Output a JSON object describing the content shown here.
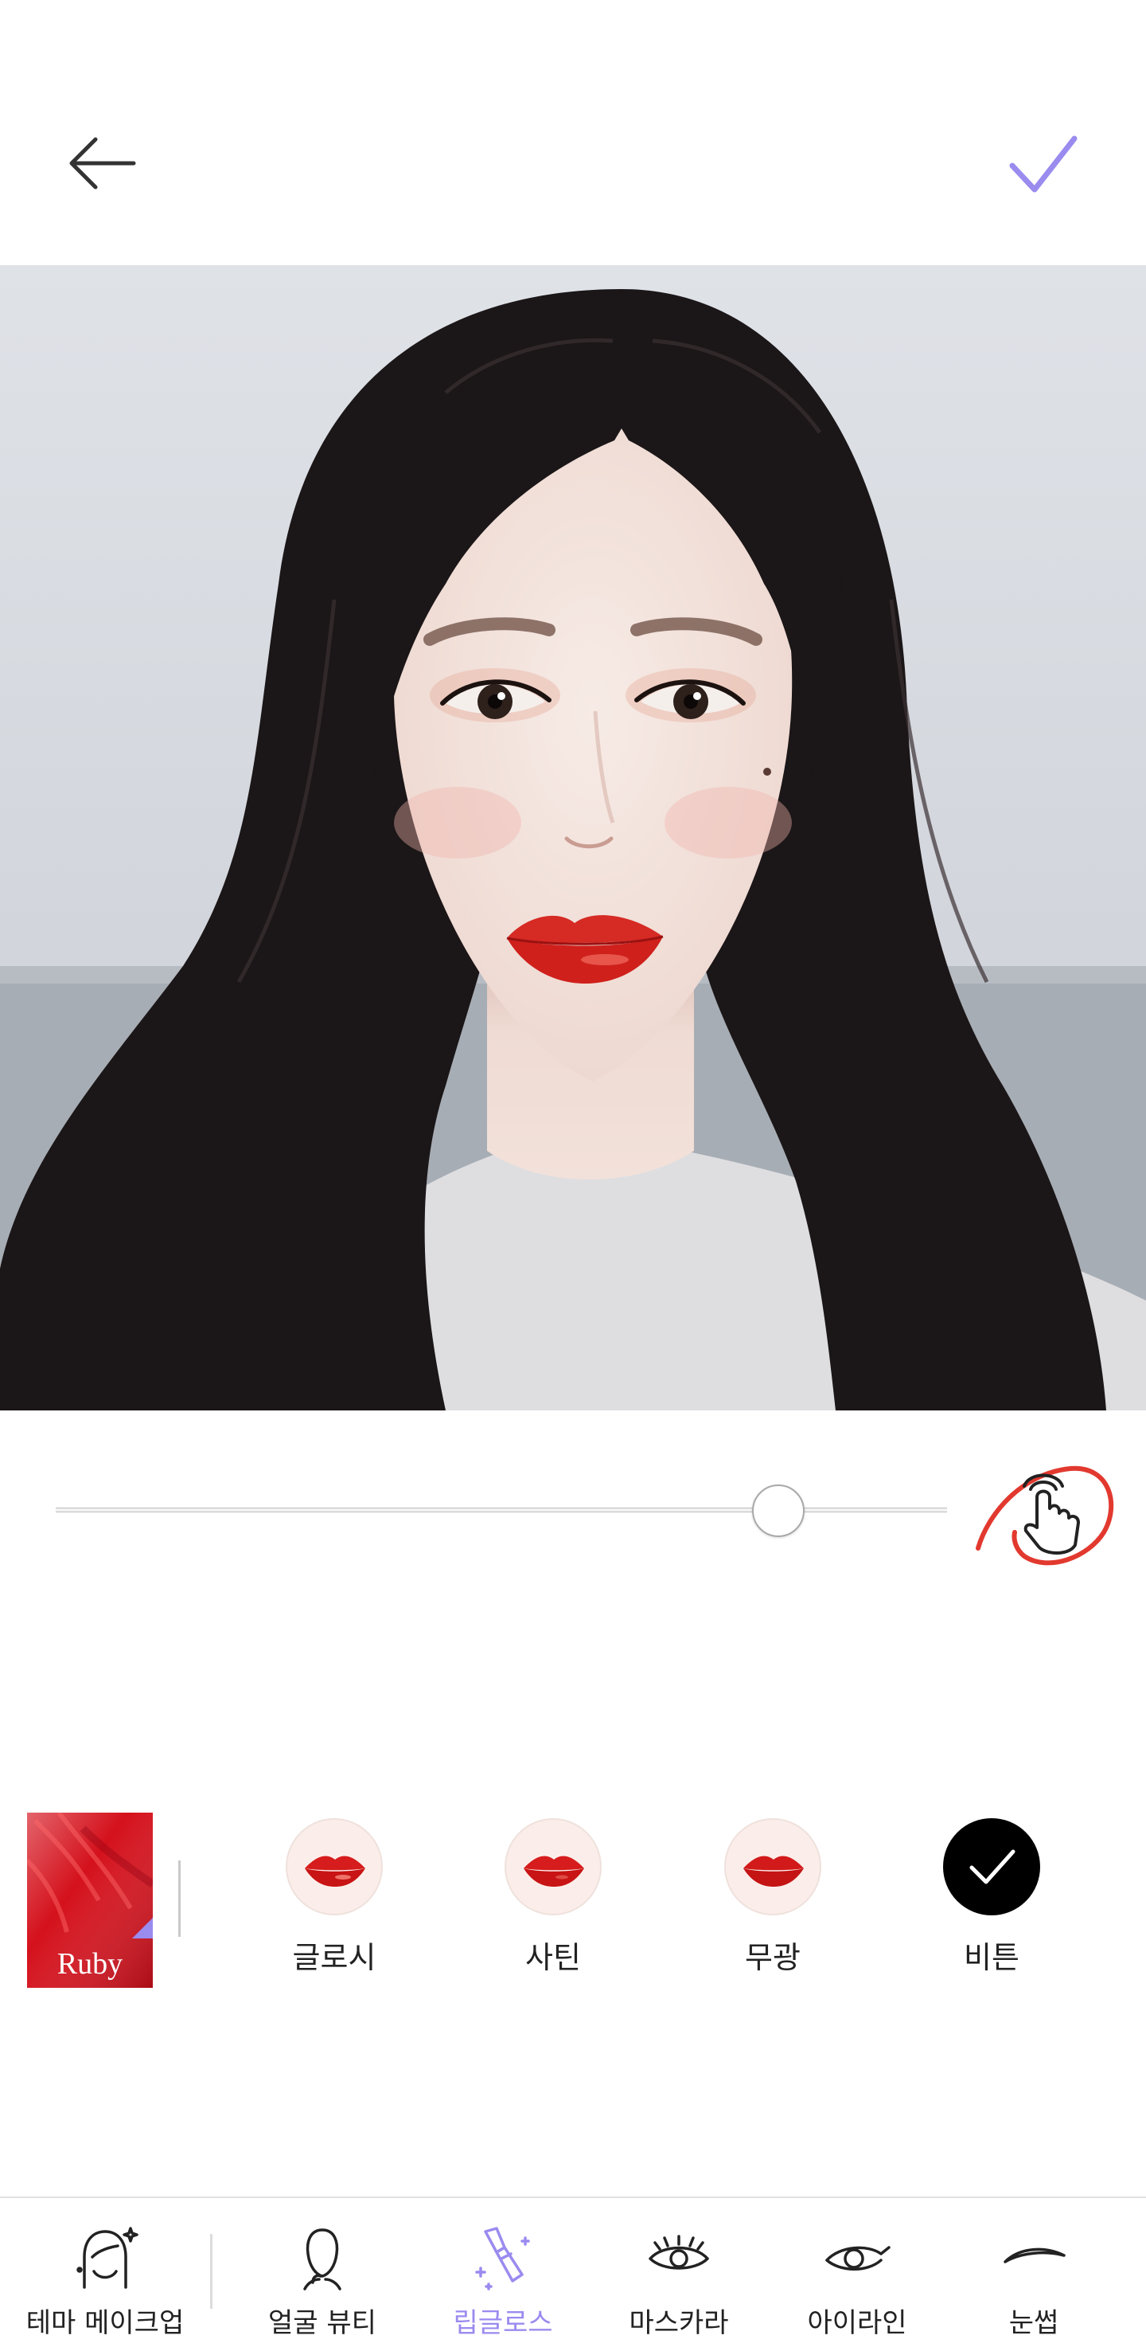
{
  "colors": {
    "accent": "#9a8bef",
    "touch_ring": "#e2392f"
  },
  "header": {
    "back_icon": "arrow-left-icon",
    "confirm_icon": "check-icon"
  },
  "intensity_slider": {
    "value": 0.81
  },
  "touch_edit": {
    "icon": "hand-pointer-icon"
  },
  "lip_color": {
    "name": "Ruby",
    "color": "#d4111c"
  },
  "finishes": [
    {
      "label": "글로시",
      "selected": false,
      "icon": "lips-icon"
    },
    {
      "label": "사틴",
      "selected": false,
      "icon": "lips-icon"
    },
    {
      "label": "무광",
      "selected": false,
      "icon": "lips-icon"
    },
    {
      "label": "비튼",
      "selected": true,
      "icon": "check-icon"
    }
  ],
  "bottom_nav": {
    "items": [
      {
        "label": "테마 메이크업",
        "icon": "theme-makeup-icon",
        "active": false
      },
      {
        "label": "얼굴 뷰티",
        "icon": "face-beauty-icon",
        "active": false
      },
      {
        "label": "립글로스",
        "icon": "lipstick-icon",
        "active": true
      },
      {
        "label": "마스카라",
        "icon": "mascara-icon",
        "active": false
      },
      {
        "label": "아이라인",
        "icon": "eyeliner-icon",
        "active": false
      },
      {
        "label": "눈썹",
        "icon": "eyebrow-icon",
        "active": false
      }
    ]
  }
}
